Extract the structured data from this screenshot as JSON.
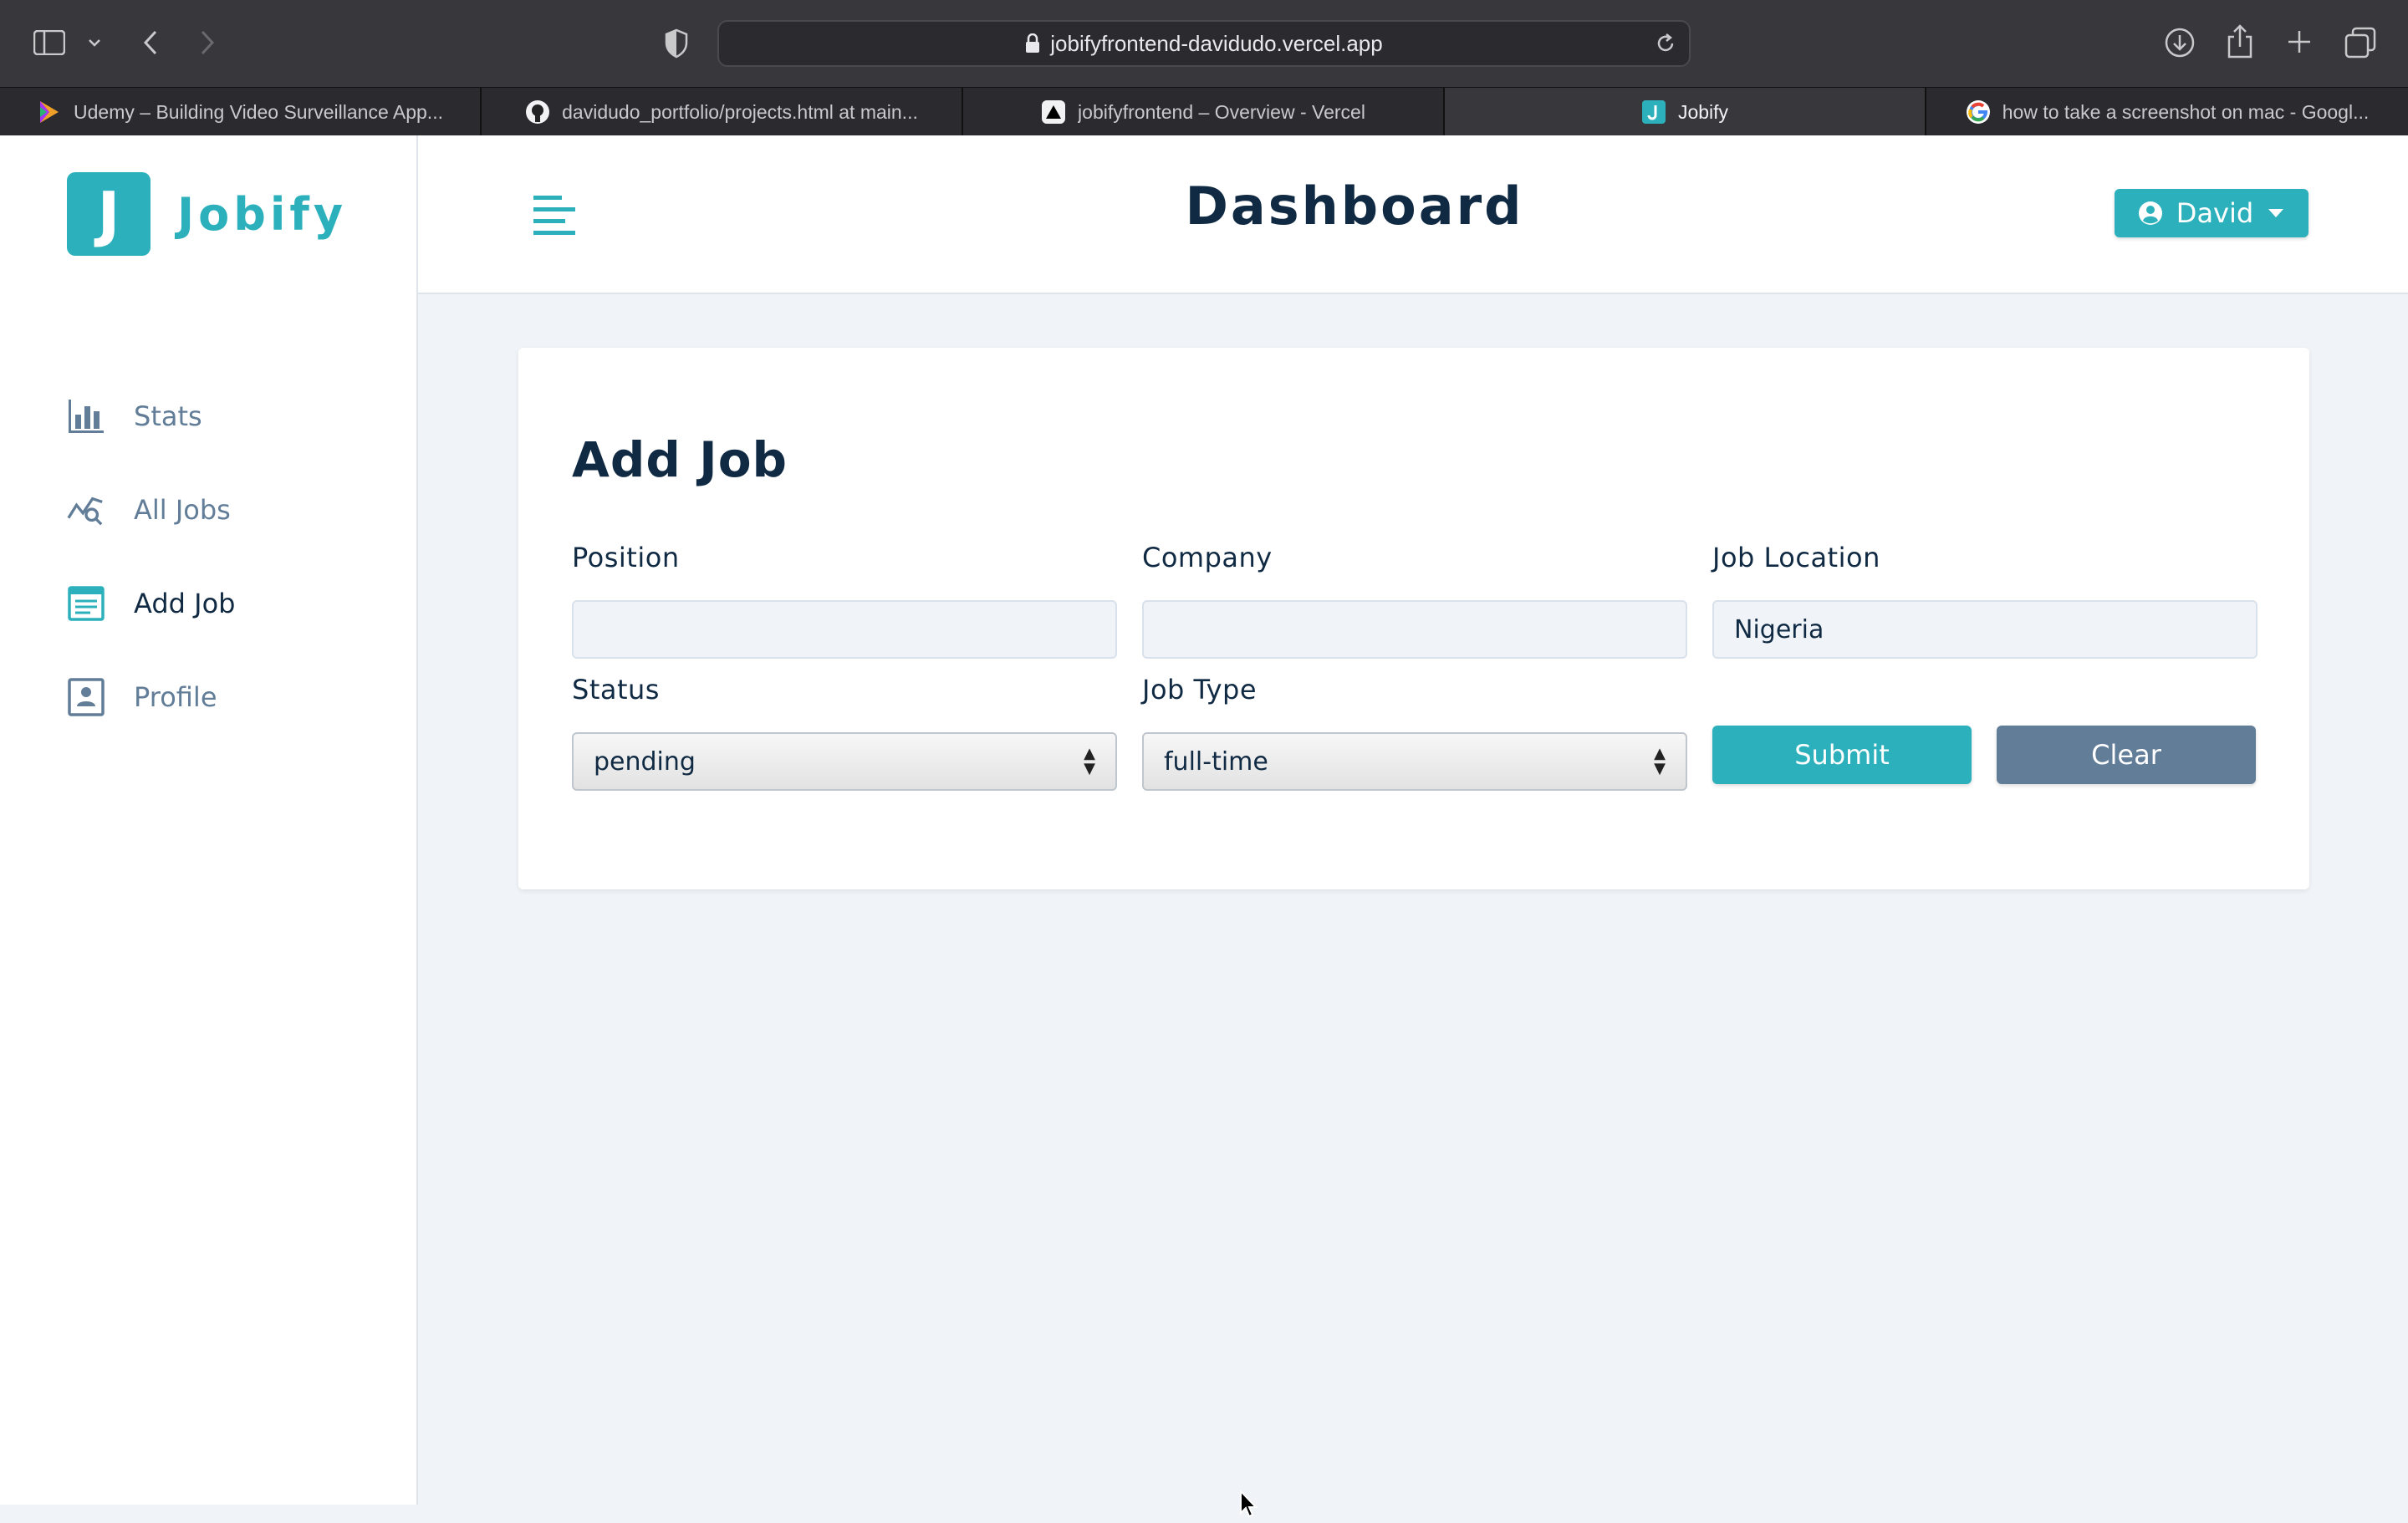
{
  "browser": {
    "url": "jobifyfrontend-davidudo.vercel.app",
    "tabs": [
      {
        "title": "Udemy – Building Video Surveillance App...",
        "favicon": "udemy-icon",
        "active": false
      },
      {
        "title": "davidudo_portfolio/projects.html at main...",
        "favicon": "github-icon",
        "active": false
      },
      {
        "title": "jobifyfrontend – Overview - Vercel",
        "favicon": "vercel-icon",
        "active": false
      },
      {
        "title": "Jobify",
        "favicon": "jobify-icon",
        "active": true
      },
      {
        "title": "how to take a screenshot on mac - Googl...",
        "favicon": "google-icon",
        "active": false
      }
    ]
  },
  "logo": {
    "letter": "J",
    "name": "Jobify"
  },
  "nav": {
    "items": [
      {
        "label": "Stats",
        "icon": "bar-chart-icon",
        "active": false
      },
      {
        "label": "All Jobs",
        "icon": "search-chart-icon",
        "active": false
      },
      {
        "label": "Add Job",
        "icon": "form-icon",
        "active": true
      },
      {
        "label": "Profile",
        "icon": "profile-card-icon",
        "active": false
      }
    ]
  },
  "header": {
    "title": "Dashboard",
    "user": "David"
  },
  "form": {
    "title": "Add Job",
    "position": {
      "label": "Position",
      "value": ""
    },
    "company": {
      "label": "Company",
      "value": ""
    },
    "location": {
      "label": "Job Location",
      "value": "Nigeria"
    },
    "status": {
      "label": "Status",
      "value": "pending"
    },
    "job_type": {
      "label": "Job Type",
      "value": "full-time"
    },
    "submit_label": "Submit",
    "clear_label": "Clear"
  },
  "colors": {
    "primary": "#2cb1bc",
    "secondary": "#627d98",
    "text": "#102a43",
    "background": "#f0f4f8"
  }
}
